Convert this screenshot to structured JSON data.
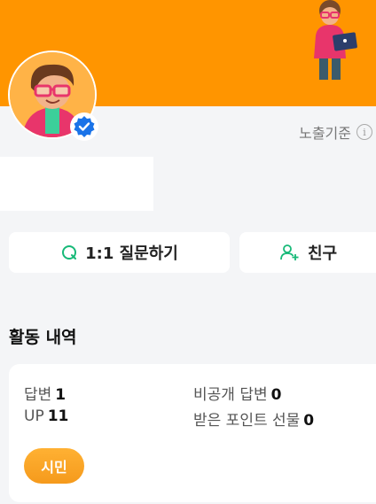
{
  "profile": {
    "criteria_label": "노출기준",
    "info_icon_glyph": "i",
    "banner_color": "#ff9500",
    "verified_color": "#1a73e8"
  },
  "actions": {
    "question_label": "1:1 질문하기",
    "friend_label": "친구",
    "icon_color": "#17b978"
  },
  "activity": {
    "title": "활동 내역",
    "answers_label": "답변",
    "answers_value": "1",
    "private_answers_label": "비공개 답변",
    "private_answers_value": "0",
    "up_label": "UP",
    "up_value": "11",
    "points_gift_label": "받은 포인트 선물",
    "points_gift_value": "0",
    "grade_badge": "시민"
  }
}
